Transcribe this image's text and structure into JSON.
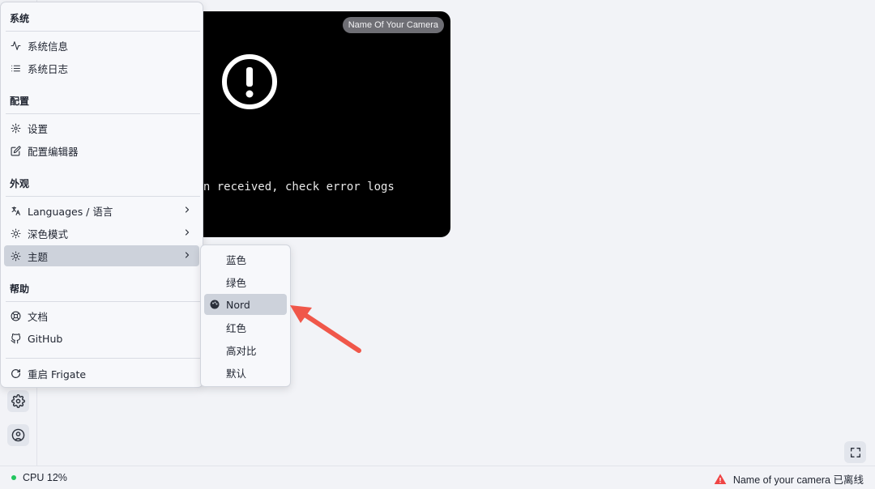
{
  "camera": {
    "name": "Name Of Your Camera",
    "message": "No frames have been received, check error logs",
    "message_visible": "een received, check error logs"
  },
  "menu": {
    "sections": [
      {
        "title": "系统",
        "items": [
          {
            "label": "系统信息",
            "icon": "activity-icon"
          },
          {
            "label": "系统日志",
            "icon": "list-icon"
          }
        ]
      },
      {
        "title": "配置",
        "items": [
          {
            "label": "设置",
            "icon": "gear-icon"
          },
          {
            "label": "配置编辑器",
            "icon": "edit-icon"
          }
        ]
      },
      {
        "title": "外观",
        "items": [
          {
            "label": "Languages / 语言",
            "icon": "translate-icon",
            "submenu": true
          },
          {
            "label": "深色模式",
            "icon": "sun-icon",
            "submenu": true
          },
          {
            "label": "主题",
            "icon": "sun-icon",
            "submenu": true,
            "active": true
          }
        ]
      },
      {
        "title": "帮助",
        "items": [
          {
            "label": "文档",
            "icon": "lifebuoy-icon"
          },
          {
            "label": "GitHub",
            "icon": "github-icon"
          }
        ]
      }
    ],
    "restart": {
      "label": "重启 Frigate",
      "icon": "refresh-icon"
    }
  },
  "theme_submenu": {
    "items": [
      "蓝色",
      "绿色",
      "Nord",
      "红色",
      "高对比",
      "默认"
    ],
    "selected": "Nord"
  },
  "status": {
    "cpu": "CPU 12%",
    "camera_offline": "Name of your camera 已离线"
  },
  "colors": {
    "background": "#f2f3f7",
    "highlight": "#cdd2db",
    "arrow": "#f0574a",
    "cpu_ok": "#22c55e",
    "warning": "#ef4444"
  }
}
